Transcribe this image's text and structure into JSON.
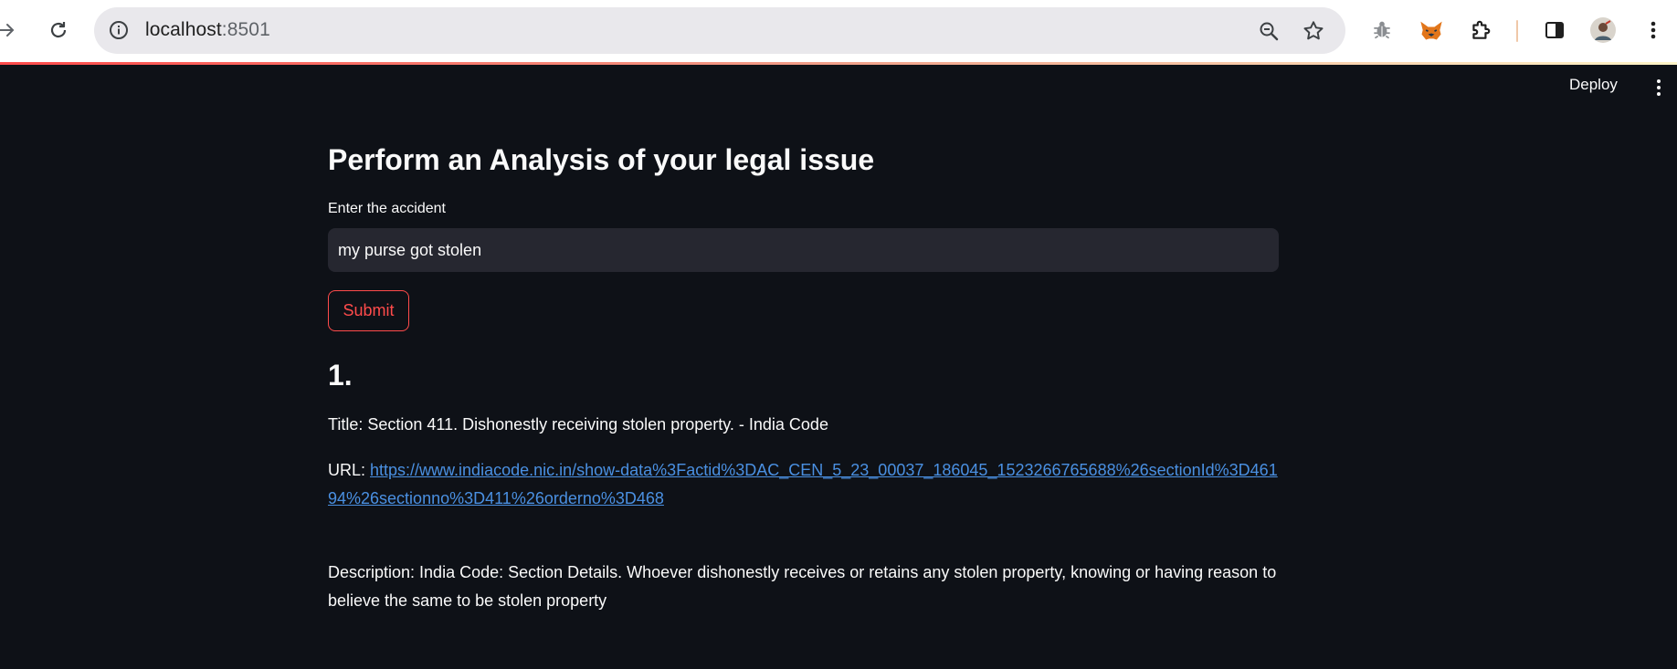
{
  "browser": {
    "url_host": "localhost",
    "url_port": ":8501",
    "icons": [
      "forward-icon",
      "reload-icon",
      "site-info-icon",
      "zoom-icon",
      "bookmark-star-icon",
      "bug-extension-icon",
      "fox-extension-icon",
      "extensions-puzzle-icon",
      "side-panel-icon",
      "profile-avatar",
      "browser-menu-icon"
    ]
  },
  "header": {
    "deploy_label": "Deploy"
  },
  "main": {
    "title": "Perform an Analysis of your legal issue",
    "input_label": "Enter the accident",
    "input_value": "my purse got stolen",
    "submit_label": "Submit"
  },
  "results": [
    {
      "number": "1.",
      "title_prefix": "Title: ",
      "title": "Section 411. Dishonestly receiving stolen property. - India Code",
      "url_prefix": "URL: ",
      "url": "https://www.indiacode.nic.in/show-data%3Factid%3DAC_CEN_5_23_00037_186045_1523266765688%26sectionId%3D46194%26sectionno%3D411%26orderno%3D468",
      "description_prefix": "Description: ",
      "description": "India Code: Section Details. Whoever dishonestly receives or retains any stolen property, knowing or having reason to believe the same to be stolen property"
    }
  ],
  "colors": {
    "app_background": "#0e1117",
    "input_background": "#262730",
    "accent_red": "#ff4b4b",
    "link_blue": "#4a90e2",
    "text": "#fafafa"
  }
}
